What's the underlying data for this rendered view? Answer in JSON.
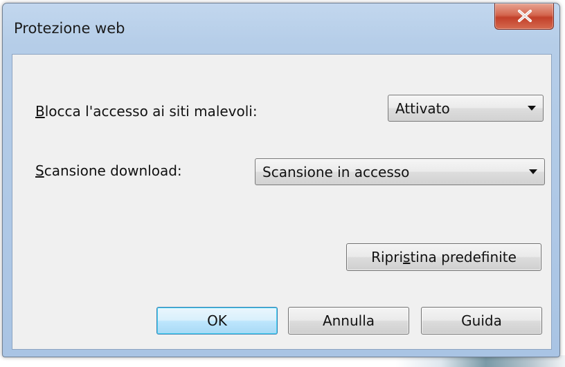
{
  "window": {
    "title": "Protezione web",
    "close_glyph": "✕"
  },
  "settings": {
    "block_sites": {
      "label_prefix": "B",
      "label_rest": "locca l'accesso ai siti malevoli:",
      "selected": "Attivato"
    },
    "download_scan": {
      "label_prefix": "S",
      "label_rest": "cansione download:",
      "selected": "Scansione in accesso"
    }
  },
  "restore": {
    "label_before": "Ripri",
    "label_accel": "s",
    "label_after": "tina predefinite"
  },
  "footer": {
    "ok": "OK",
    "cancel": "Annulla",
    "help": "Guida"
  },
  "icons": {
    "close": "close-icon",
    "dropdown": "chevron-down-icon"
  }
}
